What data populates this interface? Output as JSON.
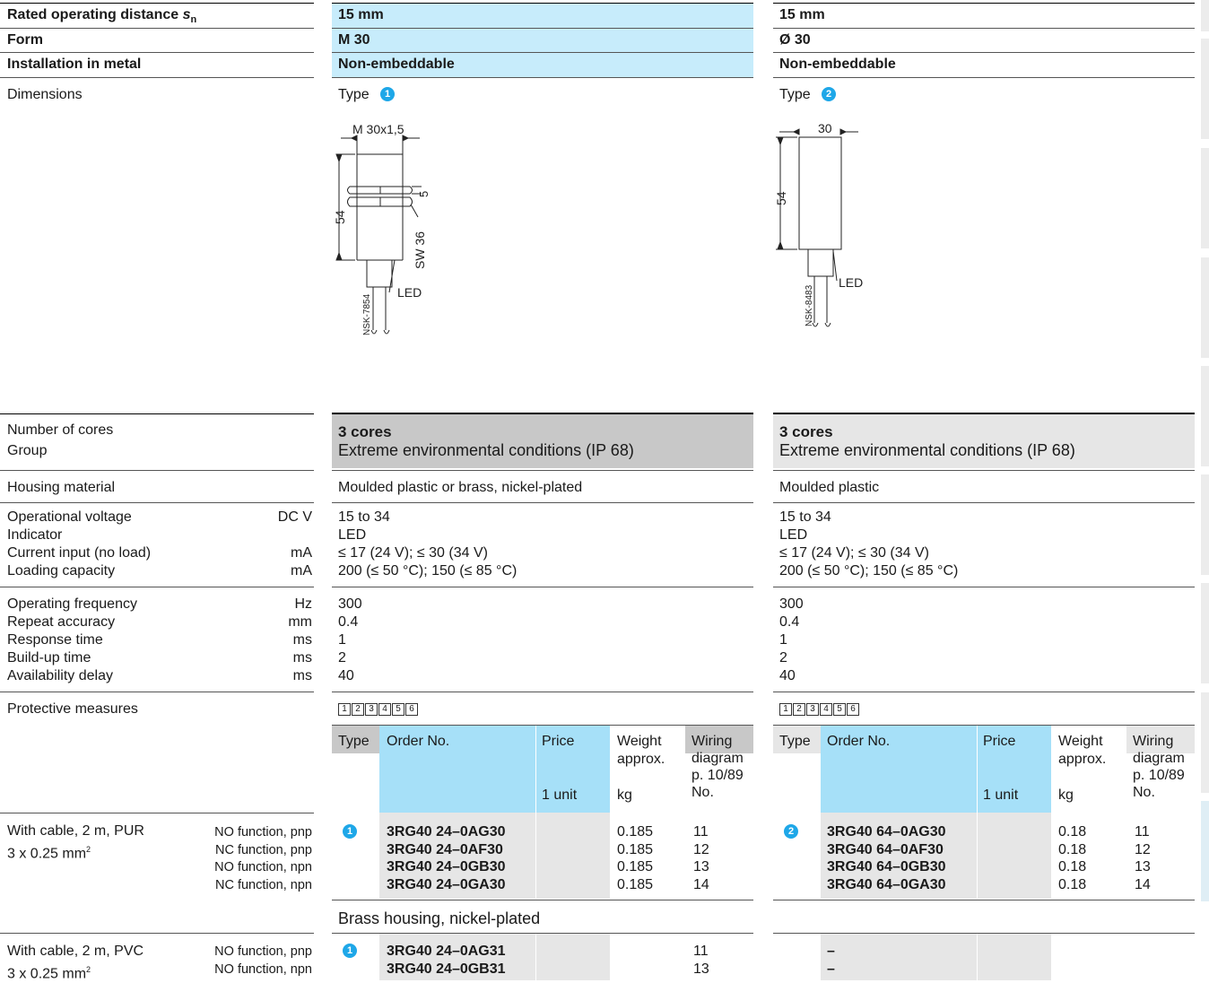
{
  "header_rows": [
    {
      "label": "Rated operating distance ",
      "label_sub": "s",
      "label_subn": "n",
      "col1": "15 mm",
      "col2": "15 mm"
    },
    {
      "label": "Form",
      "col1": "M 30",
      "col2": "Ø 30"
    },
    {
      "label": "Installation in metal",
      "col1": "Non-embeddable",
      "col2": "Non-embeddable"
    }
  ],
  "dimensions": {
    "label": "Dimensions",
    "type1": "Type",
    "type1_marker": "1",
    "type2": "Type",
    "type2_marker": "2",
    "drawing1": {
      "thread": "M 30x1,5",
      "length": "54",
      "nut": "5",
      "sw": "SW 36",
      "led": "LED",
      "ref": "NSK-7854"
    },
    "drawing2": {
      "width": "30",
      "length": "54",
      "led": "LED",
      "ref": "NSK-8483"
    }
  },
  "cores": {
    "label1": "Number of cores",
    "label2": "Group",
    "col1_cores": "3 cores",
    "col1_group": "Extreme environmental conditions (IP 68)",
    "col2_cores": "3 cores",
    "col2_group": "Extreme environmental conditions (IP 68)"
  },
  "housing": {
    "label": "Housing material",
    "col1": "Moulded plastic or brass, nickel-plated",
    "col2": "Moulded plastic"
  },
  "electrical": {
    "labels": [
      "Operational voltage",
      "Indicator",
      "Current input (no load)",
      "Loading capacity"
    ],
    "units": [
      "DC V",
      "",
      "mA",
      "mA"
    ],
    "col1": [
      "15 to 34",
      "LED",
      "≤ 17 (24 V); ≤ 30 (34 V)",
      "200 (≤ 50 °C); 150 (≤ 85 °C)"
    ],
    "col2": [
      "15 to 34",
      "LED",
      "≤ 17 (24 V); ≤ 30 (34 V)",
      "200 (≤ 50 °C); 150 (≤ 85 °C)"
    ]
  },
  "timing": {
    "labels": [
      "Operating frequency",
      "Repeat accuracy",
      "Response time",
      "Build-up time",
      "Availability delay"
    ],
    "units": [
      "Hz",
      "mm",
      "ms",
      "ms",
      "ms"
    ],
    "col1": [
      "300",
      "0.4",
      "1",
      "2",
      "40"
    ],
    "col2": [
      "300",
      "0.4",
      "1",
      "2",
      "40"
    ]
  },
  "protective": {
    "label": "Protective measures",
    "symbols": [
      "1",
      "2",
      "3",
      "4",
      "5",
      "6"
    ]
  },
  "order_header": {
    "type": "Type",
    "order_no": "Order No.",
    "price": "Price",
    "price_unit": "1 unit",
    "weight": "Weight",
    "weight2": "approx.",
    "weight_unit": "kg",
    "wiring": "Wiring",
    "wiring2": "diagram",
    "wiring3": "p. 10/89",
    "wiring_unit": "No."
  },
  "cable_pur": {
    "label1": "With cable, 2 m, PUR",
    "label2": "3 x 0.25 mm",
    "label2_sup": "2",
    "functions": [
      "NO function, pnp",
      "NC function, pnp",
      "NO function, npn",
      "NC function, npn"
    ],
    "col1_marker": "1",
    "col1_orders": [
      "3RG40 24–0AG30",
      "3RG40 24–0AF30",
      "3RG40 24–0GB30",
      "3RG40 24–0GA30"
    ],
    "col1_weights": [
      "0.185",
      "0.185",
      "0.185",
      "0.185"
    ],
    "col1_wiring": [
      "11",
      "12",
      "13",
      "14"
    ],
    "col2_marker": "2",
    "col2_orders": [
      "3RG40 64–0AG30",
      "3RG40 64–0AF30",
      "3RG40 64–0GB30",
      "3RG40 64–0GA30"
    ],
    "col2_weights": [
      "0.18",
      "0.18",
      "0.18",
      "0.18"
    ],
    "col2_wiring": [
      "11",
      "12",
      "13",
      "14"
    ]
  },
  "brass": {
    "label": "Brass housing, nickel-plated"
  },
  "cable_pvc": {
    "label1": "With cable, 2 m, PVC",
    "label2": "3 x 0.25 mm",
    "label2_sup": "2",
    "functions": [
      "NO function, pnp",
      "NO function, npn"
    ],
    "col1_marker": "1",
    "col1_orders": [
      "3RG40 24–0AG31",
      "3RG40 24–0GB31"
    ],
    "col1_wiring": [
      "11",
      "13"
    ],
    "col2_orders": [
      "–",
      "–"
    ]
  },
  "colors": {
    "light_blue": "#c7ecfb",
    "header_blue": "#a6e0f8",
    "grey": "#c8c8c8",
    "light_grey": "#e6e6e6",
    "marker": "#1ea7e8"
  }
}
